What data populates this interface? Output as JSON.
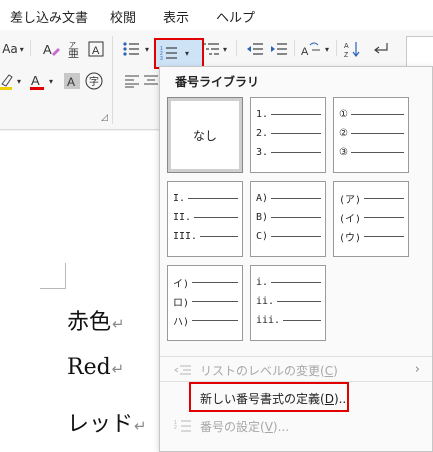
{
  "menu": {
    "items": [
      "差し込み文書",
      "校閲",
      "表示",
      "ヘルプ"
    ]
  },
  "ribbon": {
    "font_size_prefix": "Aa"
  },
  "dropdown": {
    "title": "番号ライブラリ",
    "none_label": "なし",
    "tiles": [
      [
        "1.",
        "2.",
        "3."
      ],
      [
        "①",
        "②",
        "③"
      ],
      [
        "I.",
        "II.",
        "III."
      ],
      [
        "A)",
        "B)",
        "C)"
      ],
      [
        "(ア)",
        "(イ)",
        "(ウ)"
      ],
      [
        "イ)",
        "ロ)",
        "ハ)"
      ],
      [
        "i.",
        "ii.",
        "iii."
      ]
    ],
    "cmd_change_level": {
      "text": "リストのレベルの変更(",
      "key": "C",
      "tail": ")"
    },
    "cmd_define_new": {
      "text": "新しい番号書式の定義(",
      "key": "D",
      "tail": ")..."
    },
    "cmd_set_value": {
      "text": "番号の設定(",
      "key": "V",
      "tail": ")..."
    }
  },
  "document": {
    "lines": [
      {
        "text": "赤色",
        "mark": "↵"
      },
      {
        "text": "Red",
        "mark": "↵"
      },
      {
        "text": "レッド",
        "mark": "↵"
      }
    ]
  },
  "colors": {
    "highlight_red": "#e00000",
    "font_color_red": "#e00000",
    "highlight_yellow": "#f0d000"
  }
}
